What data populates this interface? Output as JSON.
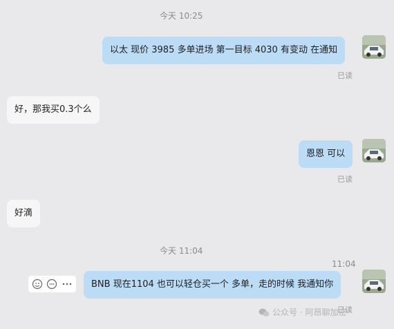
{
  "messages": [
    {
      "type": "time",
      "text": "今天 10:25"
    },
    {
      "type": "sent",
      "text": "以太 现价 3985 多单进场 第一目标 4030 有变动 在通知",
      "status": "已读"
    },
    {
      "type": "received",
      "text": "好，那我买0.3个么"
    },
    {
      "type": "sent",
      "text": "恩恩 可以",
      "status": "已读"
    },
    {
      "type": "received",
      "text": "好滴"
    },
    {
      "type": "time",
      "text": "今天 11:04"
    },
    {
      "type": "time",
      "text": "11:04"
    },
    {
      "type": "sent",
      "text": "BNB 现在1104 也可以轻仓买一个 多单，走的时候 我通知你",
      "status": "已读"
    }
  ],
  "action_icons": [
    "smile-refresh-icon",
    "emoji-icon",
    "more-icon"
  ],
  "watermark": {
    "text": "公众号 · 阿昂聊加密",
    "icon": "wechat-icon"
  },
  "colors": {
    "background": "#e9e9eb",
    "sent_bubble": "#bcdcf6",
    "received_bubble": "#f6f6f6"
  }
}
